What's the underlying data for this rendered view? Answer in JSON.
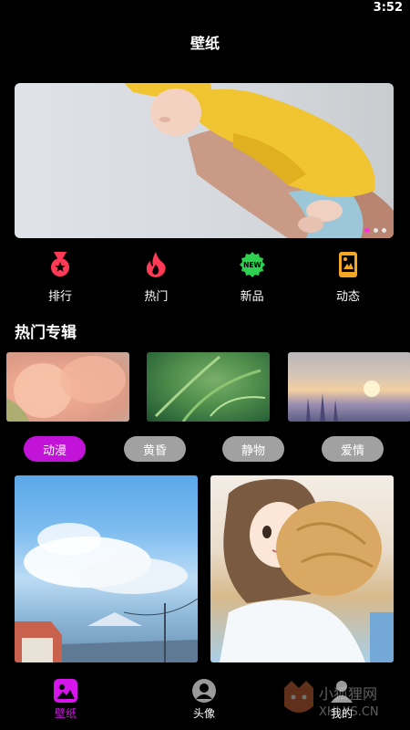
{
  "status_bar": {
    "time": "3:52"
  },
  "header": {
    "title": "壁纸"
  },
  "banner": {
    "slide_count": 3,
    "active_index": 0
  },
  "quick_nav": [
    {
      "label": "排行",
      "icon": "medal-icon",
      "color": "#ff3a56"
    },
    {
      "label": "热门",
      "icon": "flame-icon",
      "color": "#ff3a56"
    },
    {
      "label": "新品",
      "icon": "new-badge-icon",
      "color": "#2fd04f"
    },
    {
      "label": "动态",
      "icon": "live-phone-icon",
      "color": "#f5a623"
    }
  ],
  "albums": {
    "title": "热门专辑",
    "count": 3
  },
  "categories": [
    {
      "label": "动漫",
      "active": true
    },
    {
      "label": "黄昏",
      "active": false
    },
    {
      "label": "静物",
      "active": false
    },
    {
      "label": "爱情",
      "active": false
    }
  ],
  "tab_bar": [
    {
      "label": "壁纸",
      "icon": "picture-icon",
      "active": true
    },
    {
      "label": "头像",
      "icon": "avatar-icon",
      "active": false
    },
    {
      "label": "我的",
      "icon": "profile-icon",
      "active": false
    }
  ],
  "watermark": {
    "text": "小狐狸网",
    "subtext": "XHLKS.CN"
  },
  "colors": {
    "accent": "#c114d8",
    "tab_active": "#d515ea",
    "pill_inactive": "#a1a1a1",
    "background": "#000000"
  }
}
